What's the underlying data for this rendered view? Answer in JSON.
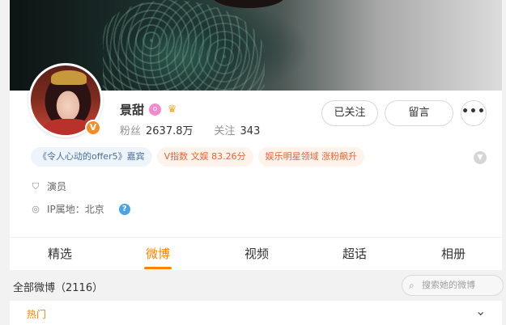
{
  "profile": {
    "name": "景甜",
    "followers_label": "粉丝",
    "followers_value": "2637.8万",
    "following_label": "关注",
    "following_value": "343",
    "verify_badge": "V",
    "level_icon": "o",
    "crown_icon": "♛"
  },
  "actions": {
    "followed_label": "已关注",
    "message_label": "留言",
    "more_label": "•••"
  },
  "tags": [
    {
      "label": "《令人心动的offer5》嘉宾",
      "kind": "show"
    },
    {
      "label": "V指数 文娱 83.26分",
      "kind": "index"
    },
    {
      "label": "娱乐明星领域 涨粉飙升",
      "kind": "rank"
    }
  ],
  "info": {
    "occupation": "演员",
    "ip_location": "IP属地：北京",
    "occupation_icon": "badge-icon",
    "ip_icon": "location-icon"
  },
  "tabs": [
    {
      "label": "精选",
      "active": false
    },
    {
      "label": "微博",
      "active": true
    },
    {
      "label": "视频",
      "active": false
    },
    {
      "label": "超话",
      "active": false
    },
    {
      "label": "相册",
      "active": false
    }
  ],
  "feed": {
    "title": "全部微博（2116）",
    "search_placeholder": "搜索她的微博",
    "hot_label": "热门"
  },
  "colors": {
    "accent": "#ff8200",
    "tag_blue_text": "#4a6f9f",
    "tag_orange_text": "#e2663a",
    "verify": "#f78c24"
  }
}
